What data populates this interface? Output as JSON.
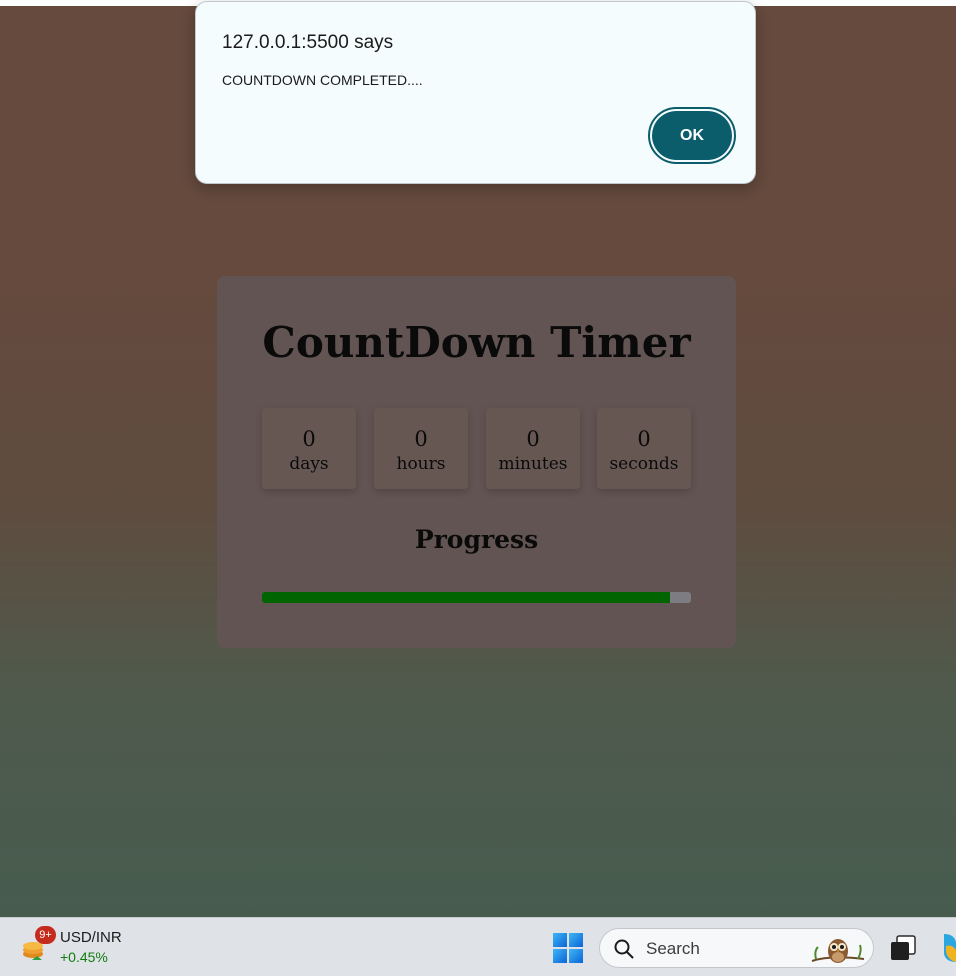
{
  "dialog": {
    "title": "127.0.0.1:5500 says",
    "message": "COUNTDOWN COMPLETED....",
    "ok_label": "OK"
  },
  "timer": {
    "title": "CountDown Timer",
    "units": [
      {
        "value": "0",
        "label": "days"
      },
      {
        "value": "0",
        "label": "hours"
      },
      {
        "value": "0",
        "label": "minutes"
      },
      {
        "value": "0",
        "label": "seconds"
      }
    ],
    "progress_title": "Progress",
    "progress_fraction": 0.95,
    "progress_color": "#006400"
  },
  "taskbar": {
    "widget": {
      "badge": "9+",
      "title": "USD/INR",
      "change": "+0.45%",
      "change_color": "#107c10",
      "icon": "coins-stack-icon"
    },
    "start_icon": "windows-logo-icon",
    "search": {
      "label": "Search",
      "icon": "search-icon",
      "decoration": "owl-icon"
    },
    "taskview_icon": "task-view-icon",
    "copilot_icon": "copilot-icon"
  },
  "colors": {
    "dialog_accent": "#0b5d6b",
    "card_bg": "#625452",
    "page_top": "#654a3d",
    "page_bottom": "#475c4f"
  }
}
